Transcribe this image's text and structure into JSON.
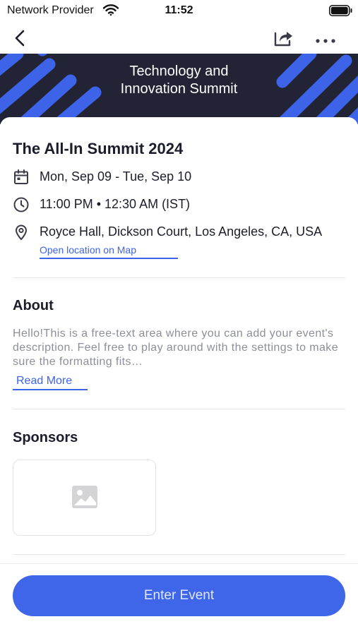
{
  "status_bar": {
    "carrier": "Network Provider",
    "time": "11:52"
  },
  "nav": {
    "back_icon": "chevron-left-icon",
    "share_icon": "share-icon",
    "more_icon": "more-horizontal-icon"
  },
  "banner": {
    "title": "Technology and\nInnovation Summit",
    "background_color": "#222436",
    "stripe_color": "#3d63e8"
  },
  "event": {
    "title": "The All-In Summit 2024",
    "date": "Mon, Sep 09 - Tue, Sep 10",
    "time": "11:00 PM • 12:30 AM (IST)",
    "location": "Royce Hall, Dickson Court, Los Angeles, CA, USA",
    "map_link": "Open location on Map"
  },
  "about": {
    "title": "About",
    "text": "Hello!This is a free-text area where you can add your event's description. Feel free to play around with the settings to make sure the formatting fits…",
    "read_more": "Read More"
  },
  "sponsors": {
    "title": "Sponsors",
    "placeholder_icon": "image-icon"
  },
  "footer": {
    "enter_button": "Enter Event",
    "accent_color": "#3f66e9"
  }
}
